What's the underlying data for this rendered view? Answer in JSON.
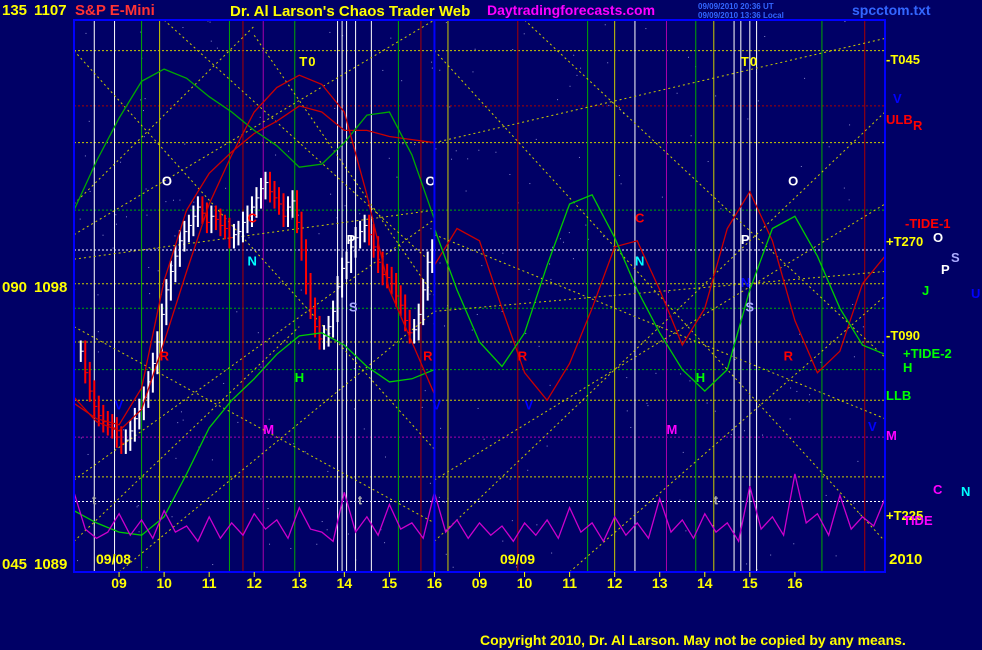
{
  "header": {
    "symbol_code": "135",
    "top_price": "1107",
    "symbol_name": "S&P E-Mini",
    "title": "Dr. Al Larson's Chaos Trader Web",
    "site": "Daytradingforecasts.com",
    "stamp1": "09/09/2010 20:36 UT",
    "stamp2": "09/09/2010 13:36 Local",
    "filename": "spcctom.txt"
  },
  "left_axis": {
    "mid_code": "090",
    "mid_price": "1098",
    "bot_code": "045",
    "bot_price": "1089"
  },
  "dates": {
    "day1": "09/08",
    "day2": "09/09",
    "year": "2010"
  },
  "footer": {
    "copyright": "Copyright 2010, Dr. Al Larson. May not be copied by any means."
  },
  "colors": {
    "background": "#000066",
    "frame": "#0000ff",
    "hours": "#ffff00",
    "grid_yellow": "#cccc00",
    "grid_green": "#00aa00",
    "grid_red": "#aa0000",
    "grid_magenta": "#aa00aa",
    "white": "#ffffff",
    "red": "#ff0000",
    "green": "#00ff00",
    "cyan": "#00ffff",
    "magenta": "#ff00ff",
    "blue": "#0000ff"
  },
  "chart_data": {
    "type": "bar",
    "ylim": [
      1089,
      1107
    ],
    "y_ticks": [
      {
        "code": "045",
        "price": 1089
      },
      {
        "code": "090",
        "price": 1098
      },
      {
        "code": "135",
        "price": 1107
      }
    ],
    "x_ticks": [
      "09",
      "10",
      "11",
      "12",
      "13",
      "14",
      "15",
      "16",
      "09",
      "10",
      "11",
      "12",
      "13",
      "14",
      "15",
      "16"
    ],
    "day_labels": [
      "09/08",
      "09/09"
    ],
    "right_labels": [
      {
        "text": "-T045",
        "color": "#ffff00"
      },
      {
        "text": "V",
        "color": "#0000ff"
      },
      {
        "text": "ULB",
        "color": "#ff0000"
      },
      {
        "text": "R",
        "color": "#ff0000"
      },
      {
        "text": "-TIDE-1",
        "color": "#ff0000"
      },
      {
        "text": "+T270",
        "color": "#ffff00"
      },
      {
        "text": "O",
        "color": "#ffffff"
      },
      {
        "text": "S",
        "color": "#aaaaff"
      },
      {
        "text": "P",
        "color": "#ffffff"
      },
      {
        "text": "J",
        "color": "#00ff00"
      },
      {
        "text": "U",
        "color": "#0000ff"
      },
      {
        "text": "-T090",
        "color": "#ffff00"
      },
      {
        "text": "+TIDE-2",
        "color": "#00ff00"
      },
      {
        "text": "H",
        "color": "#00ff00"
      },
      {
        "text": "LLB",
        "color": "#00ff00"
      },
      {
        "text": "V",
        "color": "#0000ff"
      },
      {
        "text": "M",
        "color": "#ff00ff"
      },
      {
        "text": "C",
        "color": "#ff00ff"
      },
      {
        "text": "N",
        "color": "#00ffff"
      },
      {
        "text": "+T225",
        "color": "#ffff00"
      },
      {
        "text": "TIDE",
        "color": "#ff00ff"
      }
    ],
    "markers": [
      {
        "text": "O",
        "color": "#ffffff",
        "hour": 9.95,
        "price": 1101.6
      },
      {
        "text": "O",
        "color": "#ffffff",
        "hour": 15.8,
        "price": 1101.6
      },
      {
        "text": "O",
        "color": "#ffffff",
        "hour": 23.85,
        "price": 1101.6
      },
      {
        "text": "T",
        "color": "#ffff00",
        "hour": 13.0,
        "price": 1105.5
      },
      {
        "text": "0",
        "color": "#ffff00",
        "hour": 13.2,
        "price": 1105.5
      },
      {
        "text": "T",
        "color": "#ffff00",
        "hour": 22.8,
        "price": 1105.5
      },
      {
        "text": "0",
        "color": "#ffff00",
        "hour": 23.0,
        "price": 1105.5
      },
      {
        "text": "C",
        "color": "#ff0000",
        "hour": 11.85,
        "price": 1100.4
      },
      {
        "text": "C",
        "color": "#ff0000",
        "hour": 20.45,
        "price": 1100.4
      },
      {
        "text": "N",
        "color": "#00ffff",
        "hour": 11.85,
        "price": 1099.0
      },
      {
        "text": "N",
        "color": "#00ffff",
        "hour": 20.45,
        "price": 1099.0
      },
      {
        "text": "P",
        "color": "#ffffff",
        "hour": 14.05,
        "price": 1099.7
      },
      {
        "text": "P",
        "color": "#ffffff",
        "hour": 22.8,
        "price": 1099.7
      },
      {
        "text": "S",
        "color": "#aaaaff",
        "hour": 14.1,
        "price": 1097.5
      },
      {
        "text": "S",
        "color": "#aaaaff",
        "hour": 22.9,
        "price": 1097.5
      },
      {
        "text": "R",
        "color": "#ff0000",
        "hour": 9.9,
        "price": 1095.9
      },
      {
        "text": "R",
        "color": "#ff0000",
        "hour": 15.75,
        "price": 1095.9
      },
      {
        "text": "R",
        "color": "#ff0000",
        "hour": 17.85,
        "price": 1095.9
      },
      {
        "text": "R",
        "color": "#ff0000",
        "hour": 23.75,
        "price": 1095.9
      },
      {
        "text": "H",
        "color": "#00ff00",
        "hour": 12.9,
        "price": 1095.2
      },
      {
        "text": "H",
        "color": "#00ff00",
        "hour": 21.8,
        "price": 1095.2
      },
      {
        "text": "M",
        "color": "#ff00ff",
        "hour": 12.2,
        "price": 1093.5
      },
      {
        "text": "M",
        "color": "#ff00ff",
        "hour": 21.15,
        "price": 1093.5
      },
      {
        "text": "V",
        "color": "#0000ff",
        "hour": 15.95,
        "price": 1094.3
      },
      {
        "text": "V",
        "color": "#0000ff",
        "hour": 18.0,
        "price": 1094.3
      },
      {
        "text": "N",
        "color": "#0000ff",
        "hour": 22.8,
        "price": 1098.3
      },
      {
        "text": "V",
        "color": "#0000ff",
        "hour": 8.9,
        "price": 1094.3
      },
      {
        "text": "t",
        "color": "#aaaaaa",
        "hour": 8.4,
        "price": 1091.2
      },
      {
        "text": "t",
        "color": "#aaaaaa",
        "hour": 14.3,
        "price": 1091.2
      },
      {
        "text": "t",
        "color": "#aaaaaa",
        "hour": 22.2,
        "price": 1091.2
      }
    ],
    "series": [
      {
        "name": "Price",
        "kind": "bars",
        "x": [
          8.15,
          8.25,
          8.35,
          8.45,
          8.55,
          8.65,
          8.75,
          8.85,
          8.95,
          9.05,
          9.15,
          9.25,
          9.35,
          9.45,
          9.55,
          9.65,
          9.75,
          9.85,
          9.95,
          10.05,
          10.15,
          10.25,
          10.35,
          10.45,
          10.55,
          10.65,
          10.75,
          10.85,
          10.95,
          11.05,
          11.15,
          11.25,
          11.35,
          11.45,
          11.55,
          11.65,
          11.75,
          11.85,
          11.95,
          12.05,
          12.15,
          12.25,
          12.35,
          12.45,
          12.55,
          12.65,
          12.75,
          12.85,
          12.95,
          13.05,
          13.15,
          13.25,
          13.35,
          13.45,
          13.55,
          13.65,
          13.75,
          13.85,
          13.95,
          14.05,
          14.15,
          14.25,
          14.35,
          14.45,
          14.55,
          14.65,
          14.75,
          14.85,
          14.95,
          15.05,
          15.15,
          15.25,
          15.35,
          15.45,
          15.55,
          15.65,
          15.75,
          15.85,
          15.95
        ],
        "close": [
          1096.2,
          1095.5,
          1094.9,
          1094.4,
          1094.1,
          1093.9,
          1093.8,
          1093.7,
          1093.4,
          1093.2,
          1093.3,
          1093.6,
          1094.0,
          1094.3,
          1094.7,
          1095.2,
          1095.8,
          1096.5,
          1097.4,
          1098.2,
          1098.8,
          1099.3,
          1099.8,
          1100.1,
          1100.3,
          1100.6,
          1100.9,
          1100.7,
          1100.4,
          1100.6,
          1100.5,
          1100.3,
          1100.2,
          1099.9,
          1100.0,
          1100.1,
          1100.4,
          1100.6,
          1100.9,
          1101.2,
          1101.5,
          1101.7,
          1101.4,
          1101.2,
          1101.0,
          1100.6,
          1100.9,
          1101.1,
          1100.4,
          1099.5,
          1098.4,
          1097.6,
          1097.0,
          1096.6,
          1096.7,
          1097.0,
          1097.5,
          1098.3,
          1098.9,
          1099.1,
          1099.6,
          1099.9,
          1100.1,
          1100.3,
          1100.0,
          1099.6,
          1099.1,
          1098.7,
          1098.6,
          1098.4,
          1098.0,
          1097.7,
          1097.2,
          1096.8,
          1096.9,
          1097.4,
          1098.2,
          1099.1,
          1099.5
        ]
      },
      {
        "name": "ULB",
        "color": "#cc0000",
        "x": [
          8.0,
          8.5,
          9.0,
          9.5,
          10.0,
          10.5,
          11.0,
          11.5,
          12.0,
          12.5,
          13.0,
          13.5,
          14.0,
          14.5,
          15.0,
          15.5,
          16.0
        ],
        "y": [
          1094.5,
          1094.0,
          1093.8,
          1095.0,
          1098.5,
          1100.8,
          1102.0,
          1102.7,
          1103.3,
          1103.7,
          1104.2,
          1104.0,
          1103.4,
          1103.4,
          1103.2,
          1103.1,
          1103.0
        ]
      },
      {
        "name": "LLB",
        "color": "#00cc00",
        "x": [
          8.0,
          8.5,
          9.0,
          9.5,
          10.0,
          10.5,
          11.0,
          11.5,
          12.0,
          12.5,
          13.0,
          13.5,
          14.0,
          14.5,
          15.0,
          15.5,
          16.0
        ],
        "y": [
          1091.0,
          1090.6,
          1090.3,
          1090.2,
          1090.8,
          1092.2,
          1093.7,
          1094.6,
          1095.3,
          1096.1,
          1096.7,
          1096.8,
          1096.4,
          1095.7,
          1095.2,
          1095.3,
          1095.6
        ]
      },
      {
        "name": "-TIDE-1",
        "color": "#cc0000",
        "x": [
          16.0,
          16.5,
          17.0,
          17.5,
          18.0,
          18.5,
          19.0,
          19.5,
          20.0,
          20.5,
          21.0,
          21.5,
          22.0,
          22.5,
          23.0,
          23.5,
          24.0,
          24.5,
          25.0,
          25.5,
          26.0
        ],
        "y": [
          1099.0,
          1100.2,
          1099.8,
          1097.6,
          1095.5,
          1094.6,
          1095.8,
          1097.6,
          1099.6,
          1099.8,
          1098.2,
          1096.4,
          1097.6,
          1100.2,
          1101.4,
          1099.8,
          1097.2,
          1095.5,
          1096.2,
          1098.4,
          1099.3
        ]
      },
      {
        "name": "+TIDE-2",
        "color": "#00cc00",
        "x": [
          16.0,
          16.5,
          17.0,
          17.5,
          18.0,
          18.5,
          19.0,
          19.5,
          20.0,
          20.5,
          21.0,
          21.5,
          22.0,
          22.5,
          23.0,
          23.5,
          24.0,
          24.5,
          25.0,
          25.5,
          26.0
        ],
        "y": [
          1100.2,
          1098.2,
          1096.5,
          1095.7,
          1096.8,
          1099.0,
          1101.0,
          1101.3,
          1099.9,
          1098.2,
          1096.8,
          1095.6,
          1094.9,
          1095.6,
          1098.2,
          1100.2,
          1100.6,
          1099.3,
          1097.6,
          1096.4,
          1096.1
        ]
      },
      {
        "name": "Green",
        "color": "#00aa00",
        "x": [
          8.0,
          8.5,
          9.0,
          9.5,
          10.0,
          10.5,
          11.0,
          11.5,
          12.0,
          12.5,
          13.0,
          13.5,
          14.0,
          14.5,
          15.0,
          15.5,
          16.0
        ],
        "y": [
          1100.8,
          1102.4,
          1103.8,
          1105.0,
          1105.4,
          1105.1,
          1104.5,
          1104.0,
          1103.4,
          1102.9,
          1102.2,
          1102.3,
          1103.0,
          1103.9,
          1104.0,
          1102.6,
          1100.5
        ]
      },
      {
        "name": "Red",
        "color": "#cc0000",
        "x": [
          8.0,
          8.5,
          9.0,
          9.5,
          10.0,
          10.5,
          11.0,
          11.5,
          12.0,
          12.5,
          13.0,
          13.5,
          14.0,
          14.5,
          15.0,
          15.5,
          16.0
        ],
        "y": [
          1094.7,
          1093.9,
          1093.6,
          1094.3,
          1096.5,
          1098.8,
          1101.0,
          1102.6,
          1104.0,
          1104.8,
          1105.2,
          1104.9,
          1104.0,
          1101.3,
          1098.2,
          1096.5,
          1094.8
        ]
      },
      {
        "name": "TIDE",
        "color": "#cc00cc",
        "x": [
          8.0,
          8.25,
          8.5,
          8.75,
          9.0,
          9.25,
          9.5,
          9.75,
          10.0,
          10.25,
          10.5,
          10.75,
          11.0,
          11.25,
          11.5,
          11.75,
          12.0,
          12.25,
          12.5,
          12.75,
          13.0,
          13.25,
          13.5,
          13.75,
          14.0,
          14.25,
          14.5,
          14.75,
          15.0,
          15.25,
          15.5,
          15.75,
          16.0,
          16.25,
          16.5,
          16.75,
          17.0,
          17.25,
          17.5,
          17.75,
          18.0,
          18.25,
          18.5,
          18.75,
          19.0,
          19.25,
          19.5,
          19.75,
          20.0,
          20.25,
          20.5,
          20.75,
          21.0,
          21.25,
          21.5,
          21.75,
          22.0,
          22.25,
          22.5,
          22.75,
          23.0,
          23.25,
          23.5,
          23.75,
          24.0,
          24.25,
          24.5,
          24.75,
          25.0,
          25.25,
          25.5,
          25.75,
          26.0
        ],
        "y": [
          1091.6,
          1090.4,
          1090.1,
          1090.3,
          1090.9,
          1090.2,
          1090.7,
          1090.1,
          1091.0,
          1090.3,
          1090.5,
          1090.0,
          1090.8,
          1090.1,
          1090.6,
          1090.2,
          1090.9,
          1090.4,
          1090.7,
          1090.1,
          1091.1,
          1090.4,
          1090.3,
          1090.0,
          1091.6,
          1090.3,
          1090.8,
          1090.2,
          1091.2,
          1090.4,
          1090.6,
          1090.1,
          1091.6,
          1090.3,
          1090.7,
          1090.1,
          1090.6,
          1090.2,
          1090.5,
          1090.0,
          1090.6,
          1090.2,
          1090.7,
          1090.1,
          1091.1,
          1090.3,
          1090.6,
          1090.0,
          1090.8,
          1090.2,
          1090.6,
          1090.1,
          1091.4,
          1090.3,
          1090.7,
          1090.1,
          1090.9,
          1090.3,
          1090.6,
          1090.0,
          1091.8,
          1090.4,
          1090.8,
          1090.2,
          1092.2,
          1090.6,
          1090.9,
          1090.2,
          1091.5,
          1090.4,
          1090.8,
          1090.5,
          1091.4
        ]
      }
    ]
  }
}
